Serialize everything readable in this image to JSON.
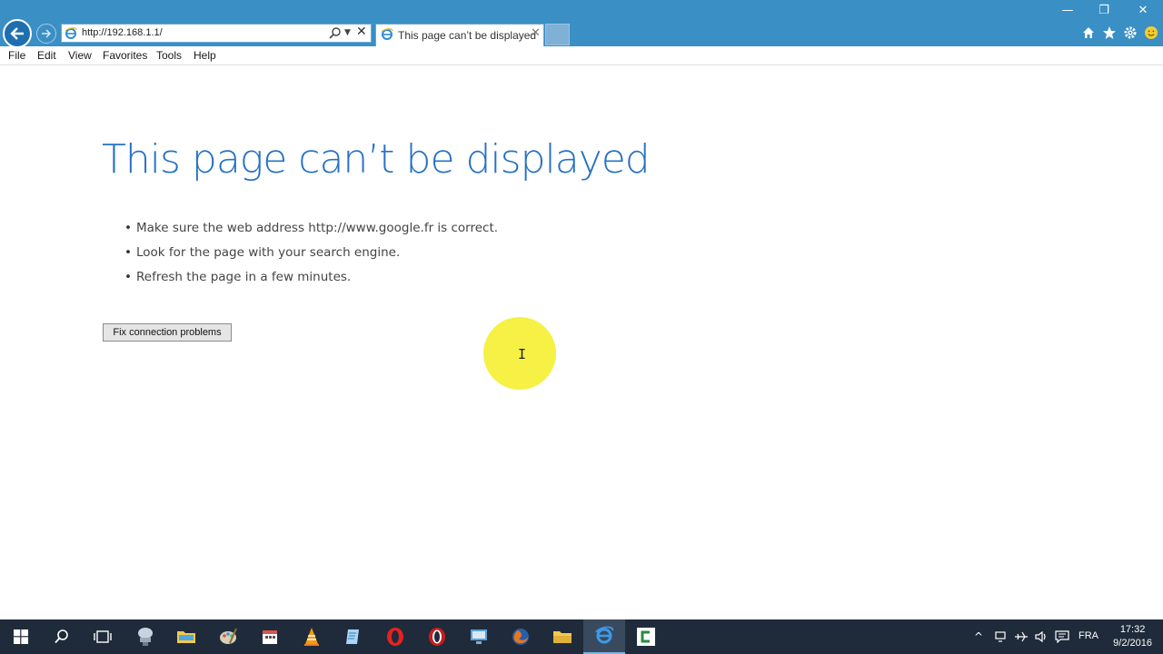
{
  "browser": {
    "address_url": "http://192.168.1.1/",
    "tab_title": "This page can’t be displayed",
    "window_controls": {
      "minimize": "—",
      "restore": "❐",
      "close": "✕"
    },
    "toolbar_icons": [
      "home-icon",
      "favorites-star-icon",
      "gear-icon",
      "smiley-feedback-icon"
    ]
  },
  "menu": {
    "items": [
      "File",
      "Edit",
      "View",
      "Favorites",
      "Tools",
      "Help"
    ]
  },
  "content": {
    "title": "This page can’t be displayed",
    "bullets": [
      "Make sure the web address http://www.google.fr is correct.",
      "Look for the page with your search engine.",
      "Refresh the page in a few minutes."
    ],
    "fix_button": "Fix connection problems"
  },
  "taskbar": {
    "apps": [
      "start",
      "search",
      "task-view",
      "network-drive",
      "folder",
      "paint",
      "calendar",
      "vlc",
      "notepad",
      "opera",
      "opera-dark",
      "remote-desktop",
      "firefox",
      "file-explorer",
      "internet-explorer",
      "camtasia"
    ],
    "active_app": "internet-explorer",
    "language": "FRA",
    "time": "17:32",
    "date": "9/2/2016"
  },
  "colors": {
    "title_bar": "#3a8fc5",
    "heading_blue": "#2672c3",
    "taskbar": "#1f2b3a",
    "cursor_highlight": "#f5f03a"
  }
}
